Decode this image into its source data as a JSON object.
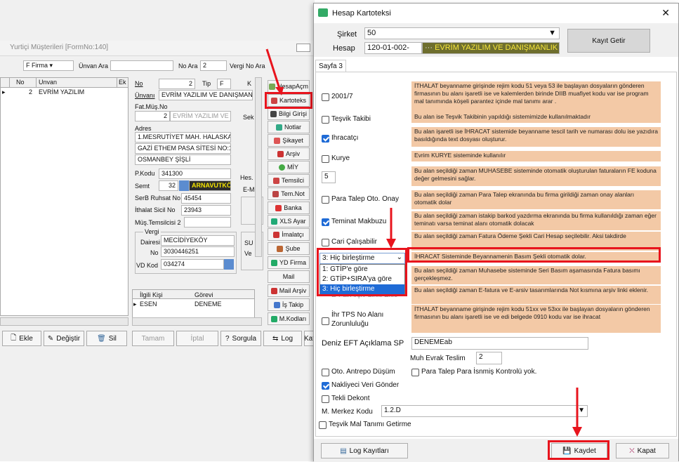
{
  "bg": {
    "title": "Yurtiçi Müşterileri [FormNo:140]",
    "filter_select": "F Firma",
    "unvan_ara": "Ünvan Ara",
    "no_ara": "No Ara",
    "no_ara_val": "2",
    "vergi_no_ara": "Vergi No Ara",
    "grid_headers": [
      "No",
      "Unvan",
      "Ek"
    ],
    "grid_row": {
      "no": "2",
      "unvan": "EVRİM YAZILIM"
    },
    "no_label": "No",
    "no_val": "2",
    "tip_label": "Tip",
    "tip_val": "F",
    "k_label": "K",
    "unvani_label": "Ünvanı",
    "unvani_val": "EVRİM YAZILIM VE DANIŞMANL",
    "fatmus_label": "Fat.Müş.No",
    "fatmus_num": "2",
    "fatmus_name": "EVRİM YAZILIM VE D",
    "adres_label": "Adres",
    "adres1": "1.MESRUTİYET MAH. HALASKA",
    "adres2": "GAZİ ETHEM PASA SİTESİ NO:1",
    "adres3": "OSMANBEY ŞİŞLİ",
    "pkodu_label": "P.Kodu",
    "pkodu_val": "341300",
    "semt_label": "Semt",
    "semt_num": "32",
    "semt_name": "ARNAVUTKÖ",
    "serb_label": "SerB Ruhsat No",
    "serb_val": "45454",
    "ithalat_label": "İthalat Sicil No",
    "ithalat_val": "23943",
    "mustem_label": "Müş.Temsilcisi",
    "mustem_val": "2",
    "vergi_title": "Vergi",
    "dairesi_label": "Dairesi",
    "dairesi_val": "MECİDİYEKÖY",
    "vno_label": "No",
    "vno_val": "3030446251",
    "vdkod_label": "VD Kod",
    "vdkod_val": "034274",
    "sek_label": "Sek",
    "hes_label": "Hes.",
    "em_label": "E-M",
    "su_label": "SU",
    "ve_label": "Ve",
    "contact_headers": [
      "İlgili Kişi",
      "Görevi"
    ],
    "contact_row": {
      "kisi": "ESEN",
      "gorevi": "DENEME"
    },
    "side_buttons": [
      "HesapAçm",
      "Kartoteks",
      "Bilgi Girişi",
      "Notlar",
      "Şikayet",
      "Arşiv",
      "MİY",
      "Temsilci",
      "Tem.Not",
      "Banka",
      "XLS Ayar",
      "İmalatçı",
      "Şube",
      "YD Firma",
      "Mail",
      "Mail Arşiv",
      "İş Takip",
      "M.Kodları"
    ],
    "bottom_buttons": [
      "Ekle",
      "Değiştir",
      "Sil",
      "Tamam",
      "İptal",
      "Sorgula",
      "Log",
      "Kat"
    ]
  },
  "dialog": {
    "title": "Hesap Kartoteksi",
    "close": "✕",
    "sirket_label": "Şirket",
    "sirket_val": "50",
    "hesap_label": "Hesap",
    "hesap_code": "120-01-002-",
    "hesap_name": "EVRİM YAZILIM VE DANIŞMANLIK",
    "kayit_getir": "Kayıt Getir",
    "tab": "Sayfa 3",
    "items": [
      {
        "label": "2001/7",
        "checked": false
      },
      {
        "label": "Teşvik Takibi",
        "checked": false
      },
      {
        "label": "Ihracatçı",
        "checked": true
      },
      {
        "label": "Kurye",
        "checked": false
      },
      {
        "label": "Para Talep Oto. Onay",
        "checked": false
      },
      {
        "label": "Teminat Makbuzu",
        "checked": true
      },
      {
        "label": "Cari Çalışabilir",
        "checked": false
      },
      {
        "label": "İhr TPS No Alanı Zorunluluğu",
        "checked": false
      }
    ],
    "number_val": "5",
    "notes": [
      "İTHALAT beyanname girişinde rejim kodu 51 veya 53 ile başlayan dosyaların gönderen firmasının bu alanı işaretli ise ve kalemlerden birinde DIIB muafiyet kodu var ise program mal tanımında köşeli parantez içinde mal tanımı arar .",
      "Bu alan ise Teşvik Takibinin yapıldığı sistemimizde kullanılmaktadır",
      "Bu alan işaretli ise İHRACAT sistemide beyanname tescil tarih ve numarası dolu ise yazıdıra basıldığında text dosyası oluşturur.",
      "Evrim KURYE sisteminde kullanılır",
      "Bu alan seçildiği zaman MUHASEBE sisteminde otomatik oluşturulan faturaların FE koduna değer gelmesini sağlar.",
      "Bu alan seçildiği zaman Para Talep ekranında bu firma girildiği zaman onay alanları otomatik dolar",
      "Bu alan seçildiği zaman istakip barkod yazdırma ekranında bu firma kullanıldığı zaman eğer teminatı varsa teminat alanı otomatik dolacak",
      "Bu alan seçildiği zaman Fatura Ödeme Şekli Cari Hesap seçilebilir. Aksi takdirde",
      "İHRACAT Sisteminde Beyannamenin Basım Şekli otomatik dolar.",
      "Bu alan seçildiği zaman Muhasebe sisteminde Seri Basım aşamasında Fatura basımı gerçekleşmez.",
      "Bu alan seçildiği zaman E-fatura ve E-arsiv tasarımlarında Not kısmına arşiv linki eklenir.",
      "İTHALAT beyanname girişinde rejim kodu 51xx ve 53xx ile başlayan dosyaların gönderen firmasının bu alanı işaretli ise ve edi belgede 0910 kodu var ise ihracat"
    ],
    "dropdown_selected": "3: Hiç birleştirme",
    "dropdown_options": [
      "1: GTİP'e göre",
      "2: GTİP+SIRA'ya göre",
      "3: Hiç birleştirme"
    ],
    "hidden_item": "E-Fat Arşiv Linki Ekle",
    "deniz_label": "Deniz EFT Açıklama SP",
    "deniz_val": "DENEMEab",
    "muh_label": "Muh Evrak Teslim",
    "muh_val": "2",
    "oto_antrepo": "Oto. Antrepo Düşüm",
    "para_talep_isim": "Para Talep Para İsnmiş Kontrolü yok.",
    "nakliyeci": "Nakliyeci Veri Gönder",
    "tekli_dekont": "Tekli Dekont",
    "merkez_label": "M. Merkez Kodu",
    "merkez_val": "1.2.D",
    "tesvik_mal": "Teşvik Mal Tanımı Getirme",
    "log_btn": "Log Kayıtları",
    "kaydet_btn": "Kaydet",
    "kapat_btn": "Kapat"
  }
}
